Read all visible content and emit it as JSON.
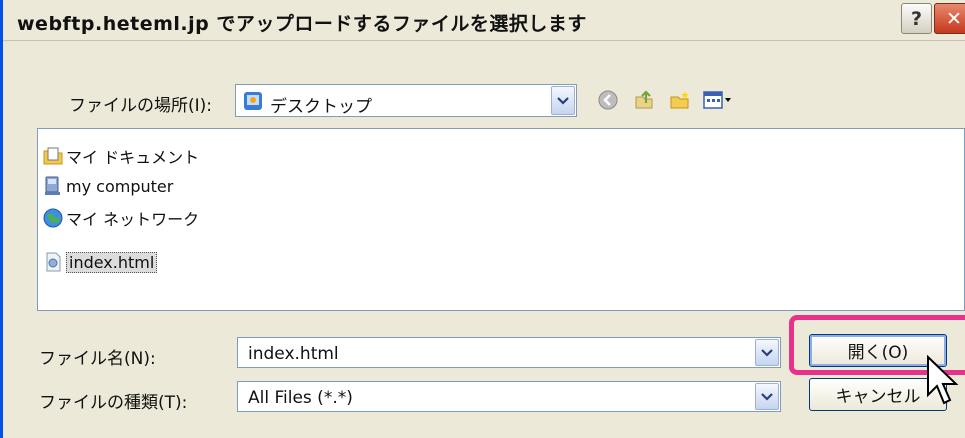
{
  "window": {
    "title": "webftp.heteml.jp でアップロードするファイルを選択します",
    "help_label": "?",
    "close_label": "✕"
  },
  "location": {
    "label": "ファイルの場所(I):",
    "value": "デスクトップ",
    "icon": "desktop-icon"
  },
  "toolbar": {
    "icons": [
      "back-icon",
      "up-folder-icon",
      "new-folder-icon",
      "view-menu-icon"
    ]
  },
  "files": [
    {
      "name": "マイ ドキュメント",
      "icon": "my-documents-folder-icon",
      "selected": false
    },
    {
      "name": "my computer",
      "icon": "my-computer-icon",
      "selected": false
    },
    {
      "name": "マイ ネットワーク",
      "icon": "my-network-icon",
      "selected": false
    },
    {
      "name": "index.html",
      "icon": "html-file-icon",
      "selected": true
    }
  ],
  "filename": {
    "label": "ファイル名(N):",
    "value": "index.html"
  },
  "filetype": {
    "label": "ファイルの種類(T):",
    "value": "All Files (*.*)"
  },
  "buttons": {
    "open_label": "開く(O)",
    "cancel_label": "キャンセル"
  },
  "colors": {
    "dialog_bg": "#ece9d8",
    "highlight": "#e8318b",
    "field_border": "#7f9db9"
  }
}
